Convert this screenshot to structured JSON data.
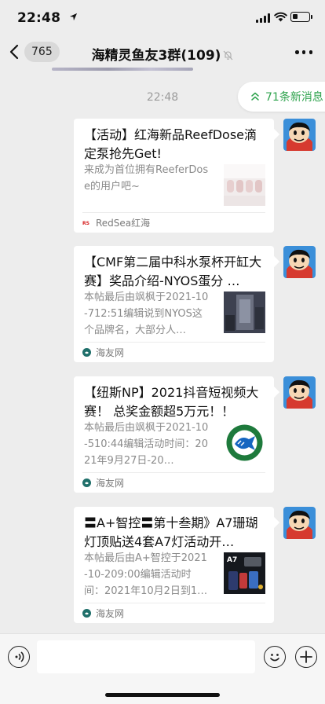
{
  "status_bar": {
    "time": "22:48",
    "battery_level": 0.35
  },
  "nav": {
    "back_count": "765",
    "title": "海精灵鱼友3群(109)"
  },
  "chat": {
    "timestamp": "22:48",
    "new_messages": "71条新消息",
    "messages": [
      {
        "title": "【活动】红海新品ReefDose滴定泵抢先Get!",
        "desc": "来成为首位拥有ReeferDose的用户吧~",
        "source": "RedSea红海"
      },
      {
        "title": "【CMF第二届中科水泵杯开缸大赛】奖品介绍-NYOS蛋分 …",
        "desc": "本帖最后由飒枫于2021-10-712:51编辑说到NYOS这个品牌名，大部分人…",
        "source": "海友网"
      },
      {
        "title": "【纽斯NP】2021抖音短视频大赛！ 总奖金额超5万元！！",
        "desc": "本帖最后由飒枫于2021-10-510:44编辑活动时间：2021年9月27日-20…",
        "source": "海友网"
      },
      {
        "title": "〓A+智控〓第十叁期》A7珊瑚灯顶贴送4套A7灯活动开…",
        "desc": "本帖最后由A+智控于2021-10-209:00编辑活动时间：2021年10月2日到1…",
        "source": "海友网",
        "thumb_text": "A7"
      }
    ]
  },
  "input": {
    "placeholder": ""
  },
  "colors": {
    "accent_green": "#2fa34e",
    "background": "#ededed"
  }
}
